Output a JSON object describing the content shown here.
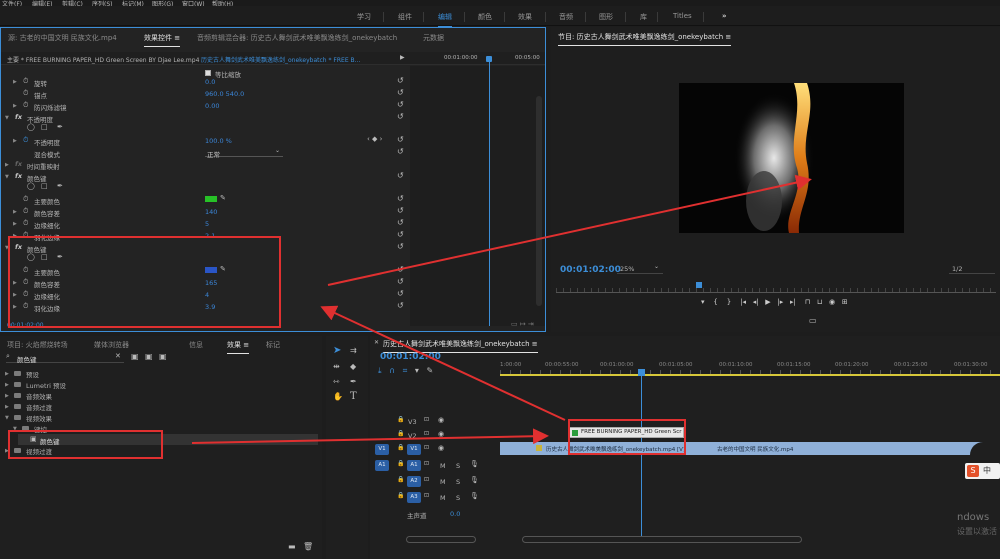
{
  "menubar": [
    "文件(F)",
    "编辑(E)",
    "剪辑(C)",
    "序列(S)",
    "标记(M)",
    "图形(G)",
    "窗口(W)",
    "帮助(H)"
  ],
  "workspaces": [
    "学习",
    "组件",
    "编辑",
    "颜色",
    "效果",
    "音频",
    "图形",
    "库",
    "Titles",
    "»"
  ],
  "active_workspace": "编辑",
  "source_tabs": {
    "source": "源: 古老的中国文明 民族文化.mp4",
    "effect_controls": "效果控件 ≡",
    "audio_mixer": "音频剪辑混合器: 历史古人舞剑武术唯美飘逸练剑_onekeybatch",
    "metadata": "元数据"
  },
  "ec_header": {
    "master": "主要 * FREE BURNING PAPER_HD Green Screen BY Djae Lee.mp4",
    "clip": "历史古人舞剑武术唯美飘逸练剑_onekeybatch * FREE B...",
    "time1": "00:01:00:00",
    "time2": "00:05:00"
  },
  "ec_rows": [
    {
      "label": "等比缩放",
      "value": ""
    },
    {
      "label": "旋转",
      "value": "0.0"
    },
    {
      "label": "锚点",
      "value": "960.0    540.0"
    },
    {
      "label": "防闪烁滤镜",
      "value": "0.00"
    },
    {
      "label": "不透明度",
      "value": ""
    },
    {
      "label": "不透明度",
      "value": "100.0 %"
    },
    {
      "label": "混合模式",
      "value": "正常"
    },
    {
      "label": "时间重映射",
      "value": ""
    },
    {
      "label": "颜色键",
      "value": ""
    },
    {
      "label": "主要颜色",
      "value": ""
    },
    {
      "label": "颜色容差",
      "value": "140"
    },
    {
      "label": "边缘细化",
      "value": "5"
    },
    {
      "label": "羽化边缘",
      "value": "2.1"
    },
    {
      "label": "颜色键",
      "value": ""
    },
    {
      "label": "主要颜色",
      "value": ""
    },
    {
      "label": "颜色容差",
      "value": "165"
    },
    {
      "label": "边缘细化",
      "value": "4"
    },
    {
      "label": "羽化边缘",
      "value": "3.9"
    }
  ],
  "ec_footer_time": "00:01:02:00",
  "program": {
    "title": "节目: 历史古人舞剑武术唯美飘逸练剑_onekeybatch ≡",
    "timecode": "00:01:02:00",
    "zoom": "25%",
    "resolution": "1/2"
  },
  "project_tabs": {
    "project": "项目: 火焰燃烧转场",
    "browser": "媒体浏览器",
    "info": "信息",
    "effects": "效果 ≡",
    "markers": "标记"
  },
  "effects_search": "颜色键",
  "effects_tree": [
    "预设",
    "Lumetri 预设",
    "音频效果",
    "音频过渡",
    "视频效果",
    "键控",
    "颜色键",
    "视频过渡"
  ],
  "timeline": {
    "title": "历史古人舞剑武术唯美飘逸练剑_onekeybatch ≡",
    "timecode": "00:01:02:00",
    "ruler": [
      "1:00:00",
      "00:00:55:00",
      "00:01:00:00",
      "00:01:05:00",
      "00:01:10:00",
      "00:01:15:00",
      "00:01:20:00",
      "00:01:25:00",
      "00:01:30:00"
    ],
    "tracks": [
      "V3",
      "V2",
      "V1",
      "A1",
      "A2",
      "A3"
    ],
    "master": "主声道",
    "master_val": "0.0",
    "clip_v2": "FREE BURNING PAPER_HD Green Scr",
    "clip_v1": "历史古人舞剑武术唯美飘逸练剑_onekeybatch.mp4 [V]",
    "clip_v1b": "古老的中国文明 民族文化.mp4"
  },
  "watermark": "ndows",
  "watermark2": "设置以激活 Wi",
  "ime": "中",
  "colors": {
    "accent": "#3c8ed8",
    "annotation": "#e03030",
    "key_green": "#27c127",
    "key_blue": "#2a55c6",
    "clip_blue": "#8fb0d8"
  }
}
